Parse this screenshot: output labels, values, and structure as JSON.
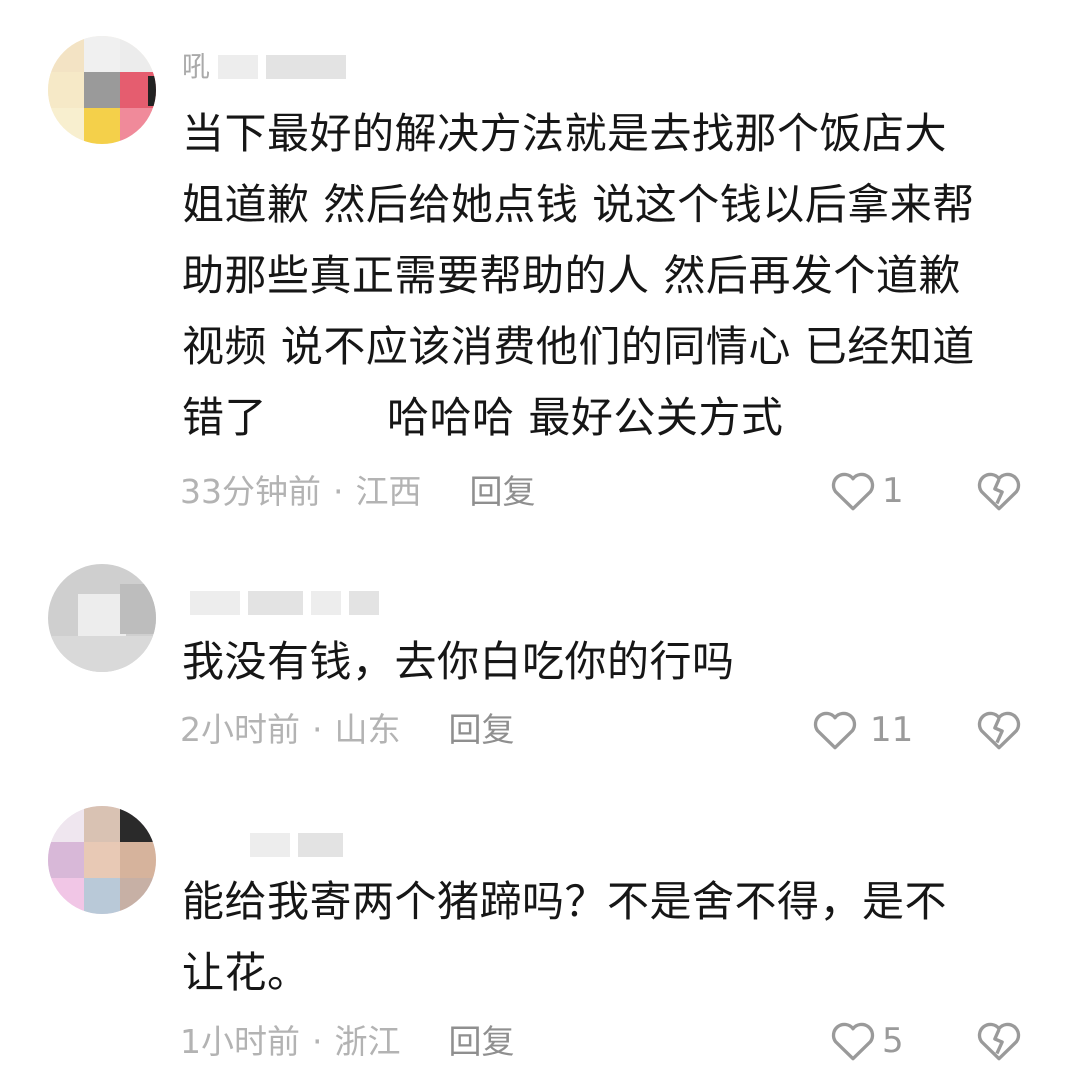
{
  "comments": [
    {
      "username_visible": "吼",
      "text_lines": [
        "当下最好的解决方法就是去找那个饭店大",
        "姐道歉 然后给她点钱 说这个钱以后拿来帮",
        "助那些真正需要帮助的人 然后再发个道歉",
        "视频 说不应该消费他们的同情心 已经知道",
        "错了",
        "哈哈哈 最好公关方式"
      ],
      "time": "33分钟前",
      "separator": "·",
      "location": "江西",
      "reply_label": "回复",
      "likes": "1"
    },
    {
      "username_visible": "",
      "text_lines": [
        "我没有钱，去你白吃你的行吗"
      ],
      "time": "2小时前",
      "separator": "·",
      "location": "山东",
      "reply_label": "回复",
      "likes": "11"
    },
    {
      "username_visible": "",
      "text_lines": [
        "能给我寄两个猪蹄吗？不是舍不得，是不",
        "让花。"
      ],
      "time": "1小时前",
      "separator": "·",
      "location": "浙江",
      "reply_label": "回复",
      "likes": "5"
    }
  ],
  "icons": {
    "like": "heart-outline-icon",
    "dislike": "broken-heart-icon"
  },
  "colors": {
    "text": "#161616",
    "meta": "#b3b3b3",
    "icon": "#9a9a9a"
  }
}
